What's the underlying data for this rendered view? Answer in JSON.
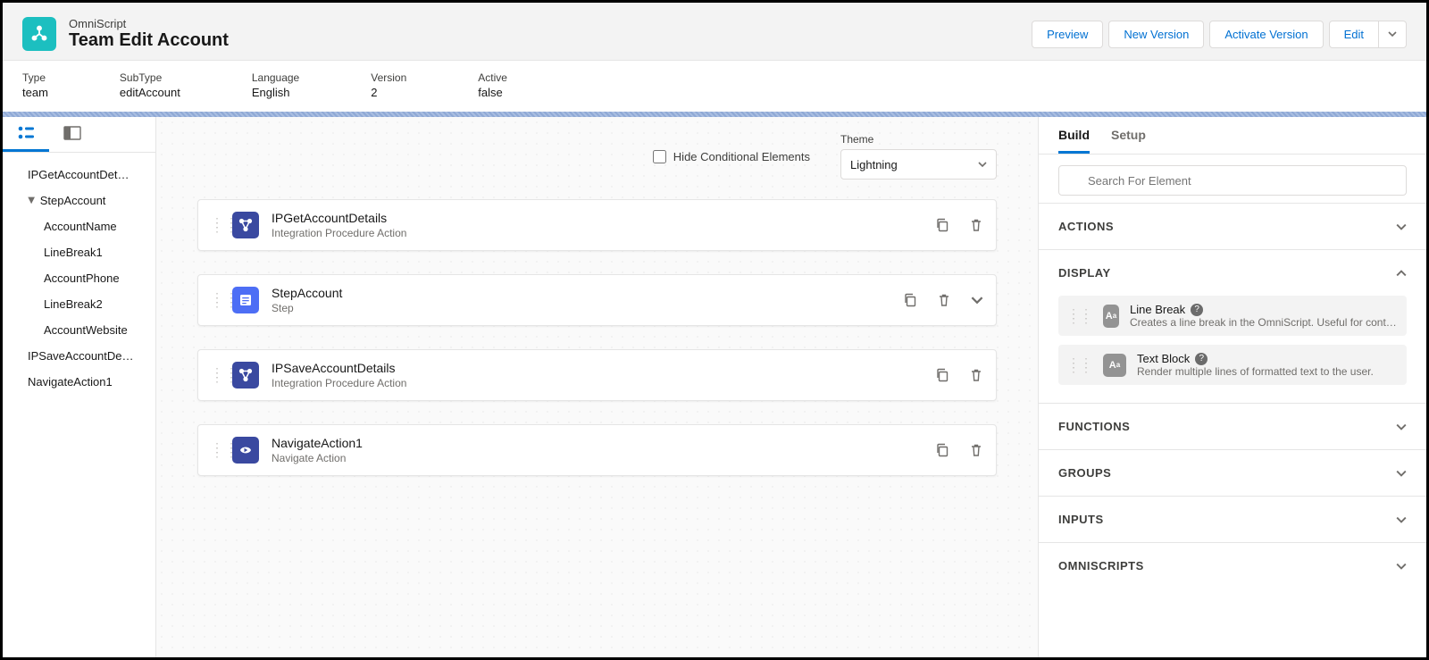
{
  "header": {
    "kicker": "OmniScript",
    "title": "Team Edit Account",
    "buttons": {
      "preview": "Preview",
      "new_version": "New Version",
      "activate": "Activate Version",
      "edit": "Edit"
    }
  },
  "meta": {
    "type": {
      "label": "Type",
      "value": "team"
    },
    "subtype": {
      "label": "SubType",
      "value": "editAccount"
    },
    "language": {
      "label": "Language",
      "value": "English"
    },
    "version": {
      "label": "Version",
      "value": "2"
    },
    "active": {
      "label": "Active",
      "value": "false"
    }
  },
  "tree": {
    "items": [
      "IPGetAccountDet…",
      "StepAccount",
      "AccountName",
      "LineBreak1",
      "AccountPhone",
      "LineBreak2",
      "AccountWebsite",
      "IPSaveAccountDe…",
      "NavigateAction1"
    ]
  },
  "canvas": {
    "hide_label": "Hide Conditional Elements",
    "theme_label": "Theme",
    "theme_value": "Lightning",
    "cards": [
      {
        "title": "IPGetAccountDetails",
        "subtitle": "Integration Procedure Action",
        "icon": "ip",
        "expandable": false
      },
      {
        "title": "StepAccount",
        "subtitle": "Step",
        "icon": "step",
        "expandable": true
      },
      {
        "title": "IPSaveAccountDetails",
        "subtitle": "Integration Procedure Action",
        "icon": "ip",
        "expandable": false
      },
      {
        "title": "NavigateAction1",
        "subtitle": "Navigate Action",
        "icon": "nav",
        "expandable": false
      }
    ]
  },
  "panel": {
    "tabs": {
      "build": "Build",
      "setup": "Setup"
    },
    "search_placeholder": "Search For Element",
    "sections": {
      "actions": "ACTIONS",
      "display": "DISPLAY",
      "functions": "FUNCTIONS",
      "groups": "GROUPS",
      "inputs": "INPUTS",
      "omniscripts": "OMNISCRIPTS"
    },
    "display_items": [
      {
        "title": "Line Break",
        "desc": "Creates a line break in the OmniScript. Useful for controllir"
      },
      {
        "title": "Text Block",
        "desc": "Render multiple lines of formatted text to the user."
      }
    ]
  }
}
